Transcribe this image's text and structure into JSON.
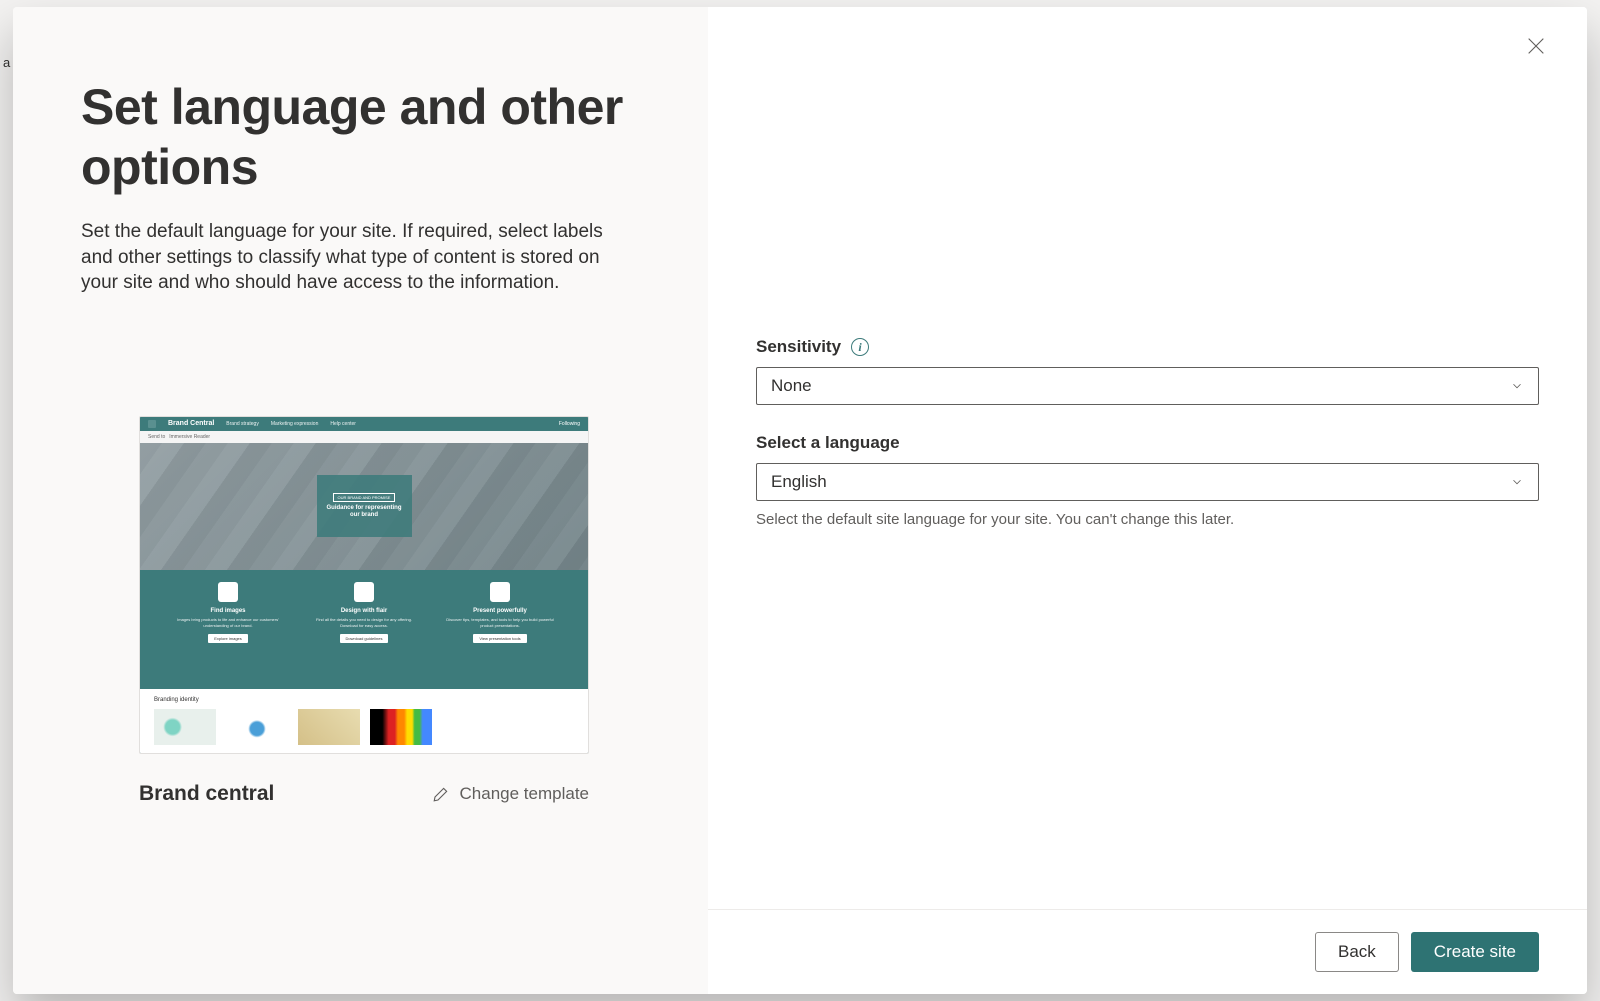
{
  "dialog": {
    "title": "Set language and other options",
    "subtitle": "Set the default language for your site. If required, select labels and other settings to classify what type of content is stored on your site and who should have access to the information.",
    "preview": {
      "name": "Brand central",
      "change_label": "Change template",
      "mock": {
        "site_name": "Brand Central",
        "nav1": "Brand strategy",
        "nav2": "Marketing expression",
        "nav3": "Help center",
        "follow": "Following",
        "sub1": "Send to",
        "sub2": "Immersive Reader",
        "hero_tag": "OUR BRAND AND PROMISE",
        "hero_title": "Guidance for representing our brand",
        "col1_title": "Find images",
        "col1_sub": "Images bring products to life and enhance our customers' understanding of our brand.",
        "col1_btn": "Explore images",
        "col2_title": "Design with flair",
        "col2_sub": "Find all the details you need to design for any offering. Download for easy access.",
        "col2_btn": "Download guidelines",
        "col3_title": "Present powerfully",
        "col3_sub": "Discover tips, templates, and tools to help you build powerful product presentations.",
        "col3_btn": "View presentation tools",
        "footer_title": "Branding identity"
      }
    }
  },
  "form": {
    "sensitivity": {
      "label": "Sensitivity",
      "value": "None"
    },
    "language": {
      "label": "Select a language",
      "value": "English",
      "helper": "Select the default site language for your site. You can't change this later."
    }
  },
  "buttons": {
    "back": "Back",
    "create": "Create site"
  }
}
